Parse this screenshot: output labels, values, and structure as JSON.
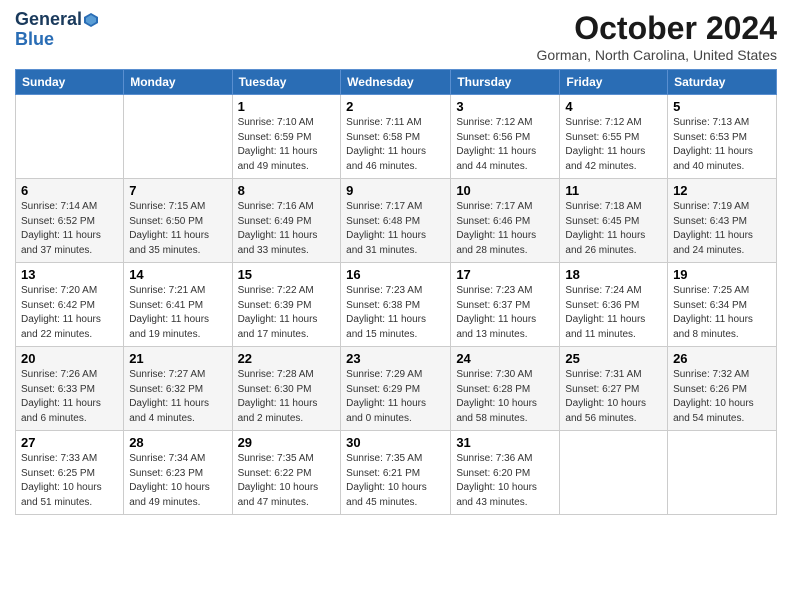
{
  "logo": {
    "line1": "General",
    "line2": "Blue"
  },
  "title": "October 2024",
  "location": "Gorman, North Carolina, United States",
  "weekdays": [
    "Sunday",
    "Monday",
    "Tuesday",
    "Wednesday",
    "Thursday",
    "Friday",
    "Saturday"
  ],
  "weeks": [
    [
      {
        "day": "",
        "sunrise": "",
        "sunset": "",
        "daylight": ""
      },
      {
        "day": "",
        "sunrise": "",
        "sunset": "",
        "daylight": ""
      },
      {
        "day": "1",
        "sunrise": "Sunrise: 7:10 AM",
        "sunset": "Sunset: 6:59 PM",
        "daylight": "Daylight: 11 hours and 49 minutes."
      },
      {
        "day": "2",
        "sunrise": "Sunrise: 7:11 AM",
        "sunset": "Sunset: 6:58 PM",
        "daylight": "Daylight: 11 hours and 46 minutes."
      },
      {
        "day": "3",
        "sunrise": "Sunrise: 7:12 AM",
        "sunset": "Sunset: 6:56 PM",
        "daylight": "Daylight: 11 hours and 44 minutes."
      },
      {
        "day": "4",
        "sunrise": "Sunrise: 7:12 AM",
        "sunset": "Sunset: 6:55 PM",
        "daylight": "Daylight: 11 hours and 42 minutes."
      },
      {
        "day": "5",
        "sunrise": "Sunrise: 7:13 AM",
        "sunset": "Sunset: 6:53 PM",
        "daylight": "Daylight: 11 hours and 40 minutes."
      }
    ],
    [
      {
        "day": "6",
        "sunrise": "Sunrise: 7:14 AM",
        "sunset": "Sunset: 6:52 PM",
        "daylight": "Daylight: 11 hours and 37 minutes."
      },
      {
        "day": "7",
        "sunrise": "Sunrise: 7:15 AM",
        "sunset": "Sunset: 6:50 PM",
        "daylight": "Daylight: 11 hours and 35 minutes."
      },
      {
        "day": "8",
        "sunrise": "Sunrise: 7:16 AM",
        "sunset": "Sunset: 6:49 PM",
        "daylight": "Daylight: 11 hours and 33 minutes."
      },
      {
        "day": "9",
        "sunrise": "Sunrise: 7:17 AM",
        "sunset": "Sunset: 6:48 PM",
        "daylight": "Daylight: 11 hours and 31 minutes."
      },
      {
        "day": "10",
        "sunrise": "Sunrise: 7:17 AM",
        "sunset": "Sunset: 6:46 PM",
        "daylight": "Daylight: 11 hours and 28 minutes."
      },
      {
        "day": "11",
        "sunrise": "Sunrise: 7:18 AM",
        "sunset": "Sunset: 6:45 PM",
        "daylight": "Daylight: 11 hours and 26 minutes."
      },
      {
        "day": "12",
        "sunrise": "Sunrise: 7:19 AM",
        "sunset": "Sunset: 6:43 PM",
        "daylight": "Daylight: 11 hours and 24 minutes."
      }
    ],
    [
      {
        "day": "13",
        "sunrise": "Sunrise: 7:20 AM",
        "sunset": "Sunset: 6:42 PM",
        "daylight": "Daylight: 11 hours and 22 minutes."
      },
      {
        "day": "14",
        "sunrise": "Sunrise: 7:21 AM",
        "sunset": "Sunset: 6:41 PM",
        "daylight": "Daylight: 11 hours and 19 minutes."
      },
      {
        "day": "15",
        "sunrise": "Sunrise: 7:22 AM",
        "sunset": "Sunset: 6:39 PM",
        "daylight": "Daylight: 11 hours and 17 minutes."
      },
      {
        "day": "16",
        "sunrise": "Sunrise: 7:23 AM",
        "sunset": "Sunset: 6:38 PM",
        "daylight": "Daylight: 11 hours and 15 minutes."
      },
      {
        "day": "17",
        "sunrise": "Sunrise: 7:23 AM",
        "sunset": "Sunset: 6:37 PM",
        "daylight": "Daylight: 11 hours and 13 minutes."
      },
      {
        "day": "18",
        "sunrise": "Sunrise: 7:24 AM",
        "sunset": "Sunset: 6:36 PM",
        "daylight": "Daylight: 11 hours and 11 minutes."
      },
      {
        "day": "19",
        "sunrise": "Sunrise: 7:25 AM",
        "sunset": "Sunset: 6:34 PM",
        "daylight": "Daylight: 11 hours and 8 minutes."
      }
    ],
    [
      {
        "day": "20",
        "sunrise": "Sunrise: 7:26 AM",
        "sunset": "Sunset: 6:33 PM",
        "daylight": "Daylight: 11 hours and 6 minutes."
      },
      {
        "day": "21",
        "sunrise": "Sunrise: 7:27 AM",
        "sunset": "Sunset: 6:32 PM",
        "daylight": "Daylight: 11 hours and 4 minutes."
      },
      {
        "day": "22",
        "sunrise": "Sunrise: 7:28 AM",
        "sunset": "Sunset: 6:30 PM",
        "daylight": "Daylight: 11 hours and 2 minutes."
      },
      {
        "day": "23",
        "sunrise": "Sunrise: 7:29 AM",
        "sunset": "Sunset: 6:29 PM",
        "daylight": "Daylight: 11 hours and 0 minutes."
      },
      {
        "day": "24",
        "sunrise": "Sunrise: 7:30 AM",
        "sunset": "Sunset: 6:28 PM",
        "daylight": "Daylight: 10 hours and 58 minutes."
      },
      {
        "day": "25",
        "sunrise": "Sunrise: 7:31 AM",
        "sunset": "Sunset: 6:27 PM",
        "daylight": "Daylight: 10 hours and 56 minutes."
      },
      {
        "day": "26",
        "sunrise": "Sunrise: 7:32 AM",
        "sunset": "Sunset: 6:26 PM",
        "daylight": "Daylight: 10 hours and 54 minutes."
      }
    ],
    [
      {
        "day": "27",
        "sunrise": "Sunrise: 7:33 AM",
        "sunset": "Sunset: 6:25 PM",
        "daylight": "Daylight: 10 hours and 51 minutes."
      },
      {
        "day": "28",
        "sunrise": "Sunrise: 7:34 AM",
        "sunset": "Sunset: 6:23 PM",
        "daylight": "Daylight: 10 hours and 49 minutes."
      },
      {
        "day": "29",
        "sunrise": "Sunrise: 7:35 AM",
        "sunset": "Sunset: 6:22 PM",
        "daylight": "Daylight: 10 hours and 47 minutes."
      },
      {
        "day": "30",
        "sunrise": "Sunrise: 7:35 AM",
        "sunset": "Sunset: 6:21 PM",
        "daylight": "Daylight: 10 hours and 45 minutes."
      },
      {
        "day": "31",
        "sunrise": "Sunrise: 7:36 AM",
        "sunset": "Sunset: 6:20 PM",
        "daylight": "Daylight: 10 hours and 43 minutes."
      },
      {
        "day": "",
        "sunrise": "",
        "sunset": "",
        "daylight": ""
      },
      {
        "day": "",
        "sunrise": "",
        "sunset": "",
        "daylight": ""
      }
    ]
  ]
}
